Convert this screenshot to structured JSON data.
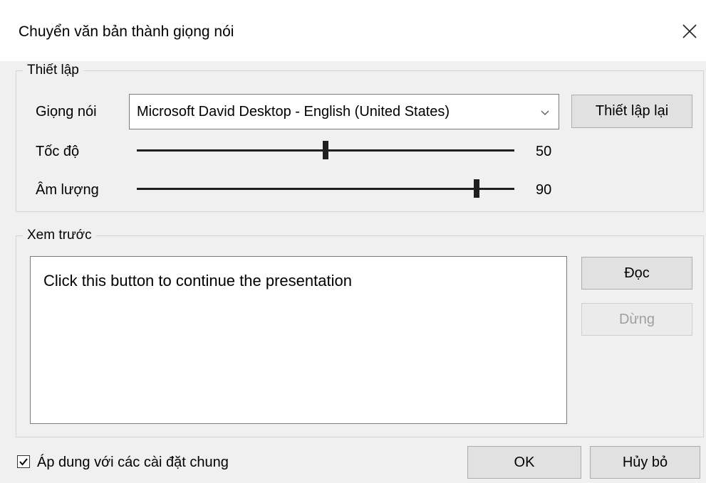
{
  "dialog": {
    "title": "Chuyển văn bản thành giọng nói",
    "close_icon": "close-icon"
  },
  "settings": {
    "group_label": "Thiết lập",
    "voice_label": "Giọng nói",
    "voice_value": "Microsoft David Desktop - English (United States)",
    "reset_button": "Thiết lập lại",
    "speed_label": "Tốc độ",
    "speed_value": "50",
    "speed_percent": 50,
    "volume_label": "Âm lượng",
    "volume_value": "90",
    "volume_percent": 90
  },
  "preview": {
    "group_label": "Xem trước",
    "text": "Click this button to continue the presentation",
    "read_button": "Đọc",
    "stop_button": "Dừng"
  },
  "footer": {
    "apply_checkbox_label": "Áp dung với các cài đặt chung",
    "apply_checked": true,
    "ok_button": "OK",
    "cancel_button": "Hủy bỏ"
  }
}
